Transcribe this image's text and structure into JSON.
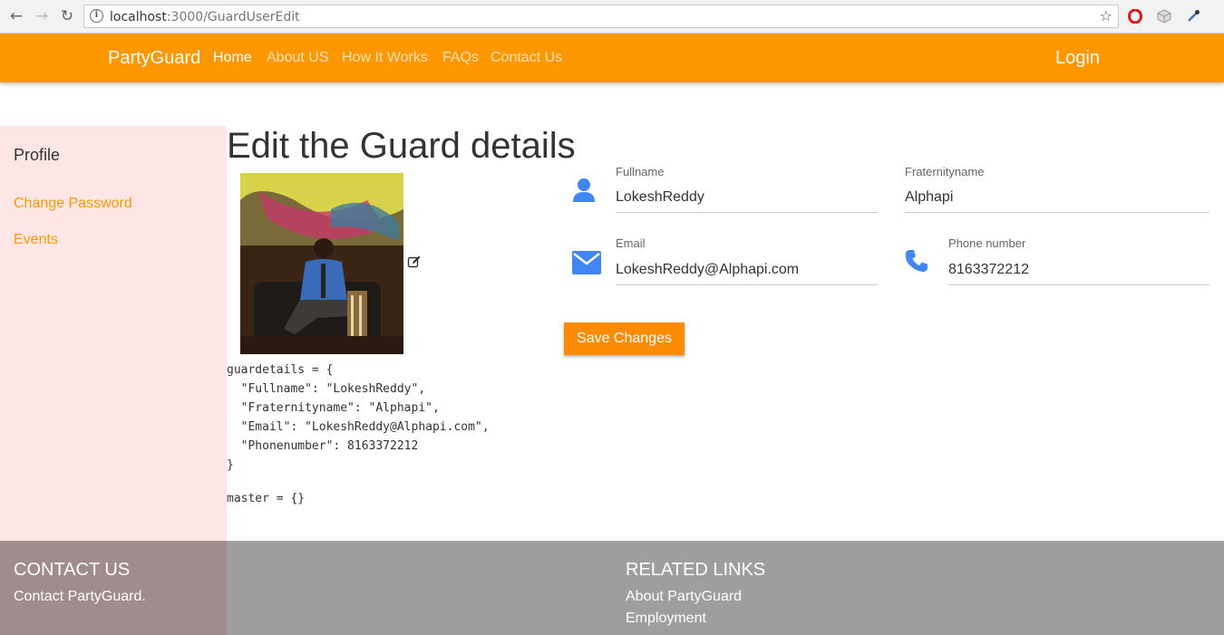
{
  "browser": {
    "url_host": "localhost",
    "url_path": ":3000/GuardUserEdit"
  },
  "navbar": {
    "brand": "PartyGuard",
    "links": [
      "Home",
      "About US",
      "How It Works",
      "FAQs",
      "Contact Us"
    ],
    "login": "Login",
    "color": "#ff9800"
  },
  "sidebar": {
    "title": "Profile",
    "links": [
      "Change Password",
      "Events"
    ],
    "background": "#ffe6e6"
  },
  "main": {
    "title": "Edit the Guard details",
    "fields": {
      "fullname": {
        "label": "Fullname",
        "value": "LokeshReddy",
        "icon": "user-icon"
      },
      "fraternityname": {
        "label": "Fraternityname",
        "value": "Alphapi"
      },
      "email": {
        "label": "Email",
        "value": "LokeshReddy@Alphapi.com",
        "icon": "envelope-icon"
      },
      "phone": {
        "label": "Phone number",
        "value": "8163372212",
        "icon": "phone-icon"
      }
    },
    "save_label": "Save Changes",
    "debug_lines": [
      "guardetails = {",
      "  \"Fullname\": \"LokeshReddy\",",
      "  \"Fraternityname\": \"Alphapi\",",
      "  \"Email\": \"LokeshReddy@Alphapi.com\",",
      "  \"Phonenumber\": 8163372212",
      "}"
    ],
    "master_line": "master = {}"
  },
  "footer": {
    "contact_heading": "CONTACT US",
    "contact_text": "Contact PartyGuard.",
    "links_heading": "RELATED LINKS",
    "links": [
      "About PartyGuard",
      "Employment"
    ]
  }
}
